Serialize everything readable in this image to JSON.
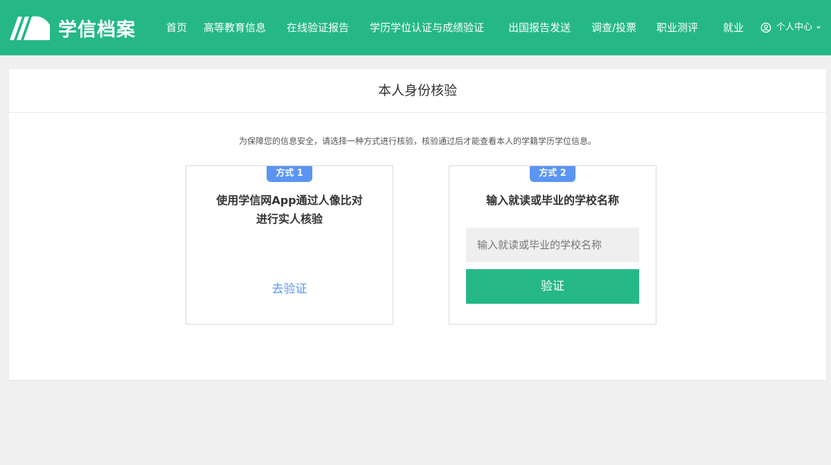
{
  "brand": {
    "name": "学信档案",
    "accent": "#25b886",
    "link_color": "#5b95f4"
  },
  "nav": {
    "items": [
      {
        "label": "首页"
      },
      {
        "label": "高等教育信息"
      },
      {
        "label": "在线验证报告"
      },
      {
        "label": "学历学位认证与成绩验证"
      },
      {
        "label": "出国报告发送"
      },
      {
        "label": "调查/投票"
      },
      {
        "label": "职业测评"
      },
      {
        "label": "就业"
      }
    ],
    "user_menu": {
      "label": "个人中心",
      "icon": "user-circle-icon"
    }
  },
  "panel": {
    "title": "本人身份核验",
    "intro": "为保障您的信息安全，请选择一种方式进行核验，核验通过后才能查看本人的学籍学历学位信息。",
    "method1": {
      "badge": "方式 1",
      "title_line1": "使用学信网App通过人像比对",
      "title_line2": "进行实人核验",
      "link": "去验证"
    },
    "method2": {
      "badge": "方式 2",
      "title": "输入就读或毕业的学校名称",
      "input_placeholder": "输入就读或毕业的学校名称",
      "input_value": "",
      "button": "验证"
    }
  }
}
